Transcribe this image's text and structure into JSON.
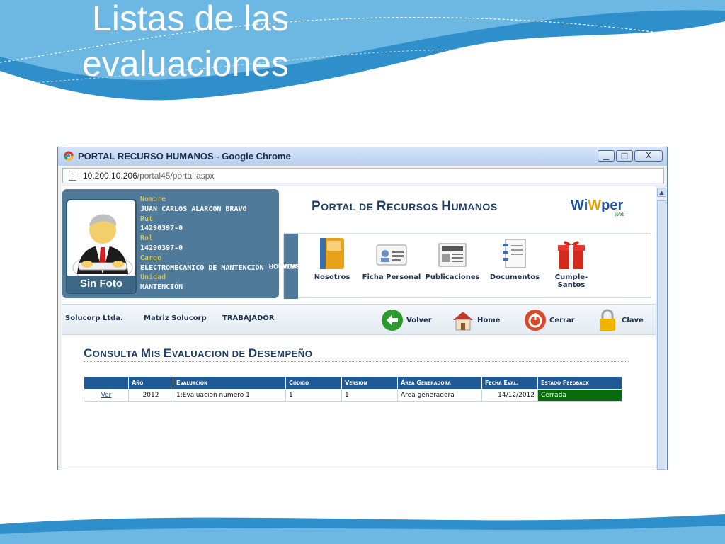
{
  "slide": {
    "title_line1": "Listas de las",
    "title_line2": "evaluaciones"
  },
  "browser": {
    "window_title": "PORTAL RECURSO HUMANOS - Google Chrome",
    "url_host": "10.200.10.206",
    "url_path": "/portal45/portal.aspx",
    "buttons": {
      "minimize": "▁",
      "maximize": "□",
      "close": "X"
    }
  },
  "profile": {
    "photo_label": "Sin Foto",
    "nombre_label": "Nombre",
    "nombre": "JUAN CARLOS ALARCON BRAVO",
    "rut_label": "Rut",
    "rut": "14290397-0",
    "rol_label": "Rol",
    "rol": "14290397-0",
    "cargo_label": "Cargo",
    "cargo": "ELECTROMECANICO DE MANTENCION",
    "unidad_label": "Unidad",
    "unidad": "MANTENCIÓN"
  },
  "header": {
    "title_p1_cap": "P",
    "title_p1": "ORTAL DE ",
    "title_p2_cap": "R",
    "title_p2": "ECURSOS ",
    "title_p3_cap": "H",
    "title_p3": "UMANOS",
    "logo_a": "Wi",
    "logo_b": "W",
    "logo_c": "per",
    "logo_sub": "Web"
  },
  "menu": {
    "side_label_1": "PORTAL",
    "side_label_2": "TRABAJADOR",
    "items": [
      {
        "label": "Nosotros",
        "icon": "book-icon"
      },
      {
        "label": "Ficha Personal",
        "icon": "id-card-icon"
      },
      {
        "label": "Publicaciones",
        "icon": "newspaper-icon"
      },
      {
        "label": "Documentos",
        "icon": "notebook-icon"
      },
      {
        "label": "Cumple-",
        "label2": "Santos",
        "icon": "gift-icon"
      }
    ]
  },
  "navbar": {
    "company": "Solucorp Ltda.",
    "matrix": "Matriz Solucorp",
    "role": "TRABAJADOR",
    "volver": "Volver",
    "home": "Home",
    "cerrar": "Cerrar",
    "clave": "Clave"
  },
  "section": {
    "t1_cap": "C",
    "t1": "ONSULTA ",
    "t2_cap": "M",
    "t2": "IS ",
    "t3_cap": "E",
    "t3": "VALUACION DE ",
    "t4_cap": "D",
    "t4": "ESEMPEÑO"
  },
  "table": {
    "headers": [
      "",
      "Año",
      "Evaluación",
      "Código",
      "Versión",
      "Área Generadora",
      "Fecha Eval.",
      "Estado Feedback"
    ],
    "rows": [
      {
        "link": "Ver",
        "anio": "2012",
        "evaluacion": "1:Evaluacion numero 1",
        "codigo": "1",
        "version": "1",
        "area": "Area generadora",
        "fecha": "14/12/2012",
        "estado": "Cerrada"
      }
    ]
  },
  "colors": {
    "slide_blue": "#2f8fcb",
    "header_blue": "#1f5a96",
    "card_blue": "#4f7a9a",
    "estado_green": "#0a6b0a"
  }
}
